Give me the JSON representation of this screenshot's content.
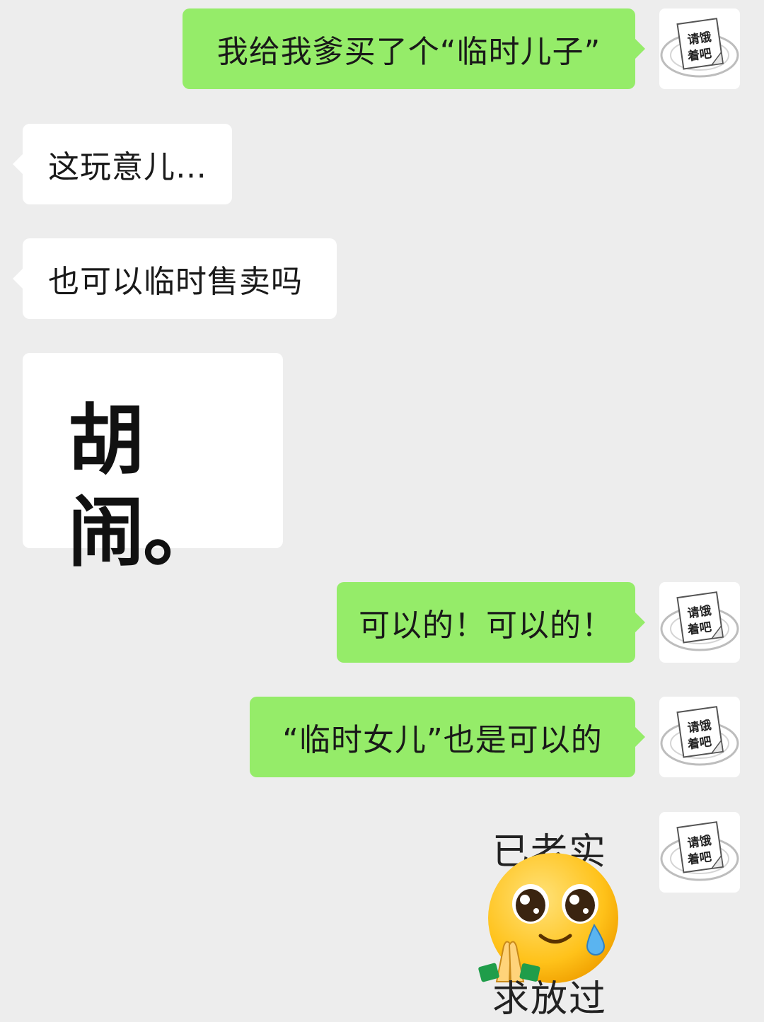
{
  "avatar": {
    "line1": "请饿",
    "line2": "着吧"
  },
  "messages": [
    {
      "side": "out",
      "text": "我给我爹买了个“临时儿子”"
    },
    {
      "side": "in",
      "text": "这玩意儿…"
    },
    {
      "side": "in",
      "text": "也可以临时售卖吗"
    },
    {
      "side": "in",
      "type": "big-text",
      "text": "胡闹。"
    },
    {
      "side": "out",
      "text": "可以的！可以的！"
    },
    {
      "side": "out",
      "text": "“临时女儿”也是可以的"
    },
    {
      "side": "out",
      "type": "sticker",
      "top_text": "已老实",
      "bottom_text": "求放过",
      "icon": "crying-pleading-emoji"
    }
  ],
  "colors": {
    "background": "#ededed",
    "outgoing_bubble": "#95ec69",
    "incoming_bubble": "#ffffff"
  }
}
